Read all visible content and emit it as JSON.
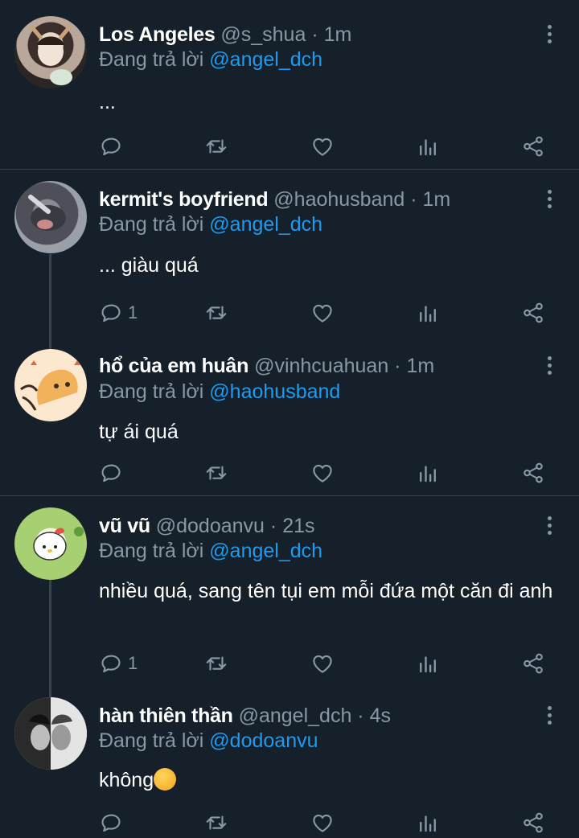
{
  "tweets": [
    {
      "name": "Los Angeles",
      "handle": "@s_shua",
      "time": "1m",
      "reply_prefix": "Đang trả lời",
      "reply_to": "@angel_dch",
      "text": "...",
      "reply_count": ""
    },
    {
      "name": "kermit's boyfriend",
      "handle": "@haohusband",
      "time": "1m",
      "reply_prefix": "Đang trả lời",
      "reply_to": "@angel_dch",
      "text": "... giàu quá",
      "reply_count": "1"
    },
    {
      "name": "hổ của em huân",
      "handle": "@vinhcuahuan",
      "time": "1m",
      "reply_prefix": "Đang trả lời",
      "reply_to": "@haohusband",
      "text": "tự ái quá",
      "reply_count": ""
    },
    {
      "name": "vũ vũ",
      "handle": "@dodoanvu",
      "time": "21s",
      "reply_prefix": "Đang trả lời",
      "reply_to": "@angel_dch",
      "text": "nhiều quá, sang tên tụi em mỗi đứa một căn đi anh",
      "reply_count": "1"
    },
    {
      "name": "hàn thiên thần",
      "handle": "@angel_dch",
      "time": "4s",
      "reply_prefix": "Đang trả lời",
      "reply_to": "@dodoanvu",
      "text": "không",
      "reply_count": ""
    }
  ],
  "separator": " · ",
  "colors": {
    "background": "#15202b",
    "muted": "#8899a6",
    "mention": "#1d9bf0",
    "divider": "#38444d"
  },
  "icons": [
    "reply-icon",
    "retweet-icon",
    "like-icon",
    "analytics-icon",
    "share-icon",
    "more-icon"
  ]
}
